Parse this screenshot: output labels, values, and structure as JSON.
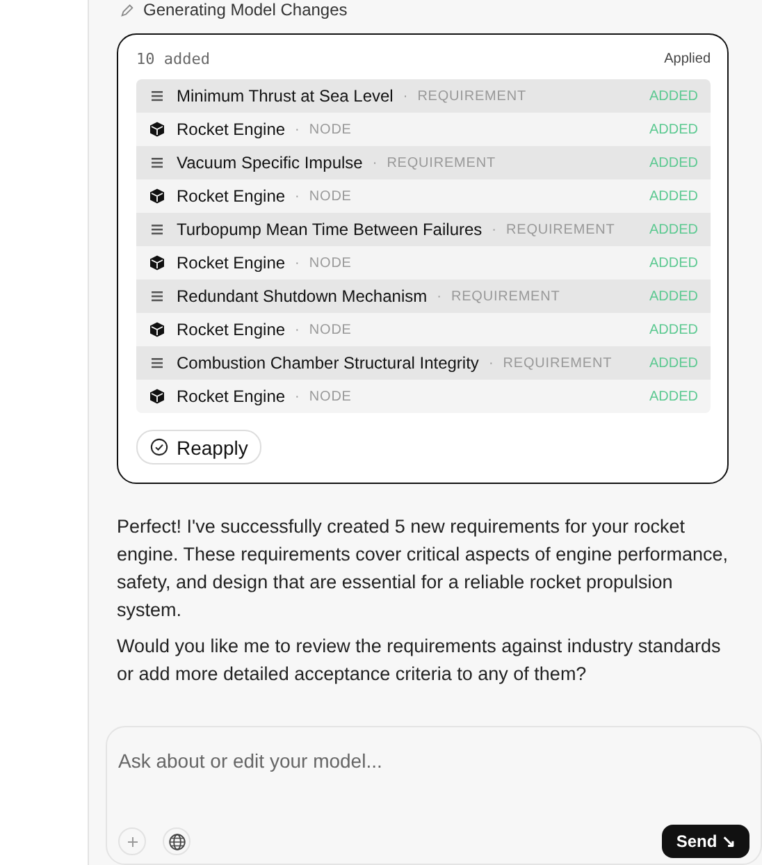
{
  "step": {
    "label": "Generating Model Changes"
  },
  "changes": {
    "summary": "10 added",
    "status": "Applied",
    "rows": [
      {
        "kind": "requirement",
        "name": "Minimum Thrust at Sea Level",
        "separator": "·",
        "type": "REQUIREMENT",
        "state": "ADDED"
      },
      {
        "kind": "node",
        "name": "Rocket Engine",
        "separator": "·",
        "type": "NODE",
        "state": "ADDED"
      },
      {
        "kind": "requirement",
        "name": "Vacuum Specific Impulse",
        "separator": "·",
        "type": "REQUIREMENT",
        "state": "ADDED"
      },
      {
        "kind": "node",
        "name": "Rocket Engine",
        "separator": "·",
        "type": "NODE",
        "state": "ADDED"
      },
      {
        "kind": "requirement",
        "name": "Turbopump Mean Time Between Failures",
        "separator": "·",
        "type": "REQUIREMENT",
        "state": "ADDED"
      },
      {
        "kind": "node",
        "name": "Rocket Engine",
        "separator": "·",
        "type": "NODE",
        "state": "ADDED"
      },
      {
        "kind": "requirement",
        "name": "Redundant Shutdown Mechanism",
        "separator": "·",
        "type": "REQUIREMENT",
        "state": "ADDED"
      },
      {
        "kind": "node",
        "name": "Rocket Engine",
        "separator": "·",
        "type": "NODE",
        "state": "ADDED"
      },
      {
        "kind": "requirement",
        "name": "Combustion Chamber Structural Integrity",
        "separator": "·",
        "type": "REQUIREMENT",
        "state": "ADDED"
      },
      {
        "kind": "node",
        "name": "Rocket Engine",
        "separator": "·",
        "type": "NODE",
        "state": "ADDED"
      }
    ],
    "button": "Reapply"
  },
  "messages": [
    "Perfect! I've successfully created 5 new requirements for your rocket engine. These requirements cover critical aspects of engine performance, safety, and design that are essential for a reliable rocket propulsion system.",
    "Would you like me to review the requirements against industry standards or add more detailed acceptance criteria to any of them?"
  ],
  "composer": {
    "placeholder": "Ask about or edit your model...",
    "send": "Send ↘"
  }
}
